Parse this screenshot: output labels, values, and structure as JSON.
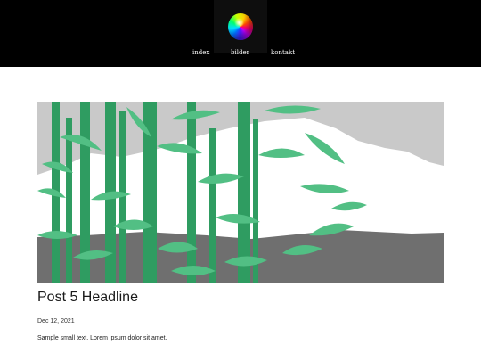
{
  "nav": {
    "items": [
      "index",
      "bilder",
      "kontakt"
    ]
  },
  "logo": {
    "icon": "gradient-sphere-logo-icon"
  },
  "post": {
    "image_description_icon": "bamboo-mountain-illustration",
    "headline": "Post 5 Headline",
    "date": "Dec 12, 2021",
    "text": "Sample small text. Lorem ipsum dolor sit amet."
  },
  "colors": {
    "header_bg": "#000000",
    "bamboo": "#2f9c61",
    "leaf": "#52bf84",
    "sky": "#c9c9c9",
    "ground": "#6f6f6f"
  }
}
